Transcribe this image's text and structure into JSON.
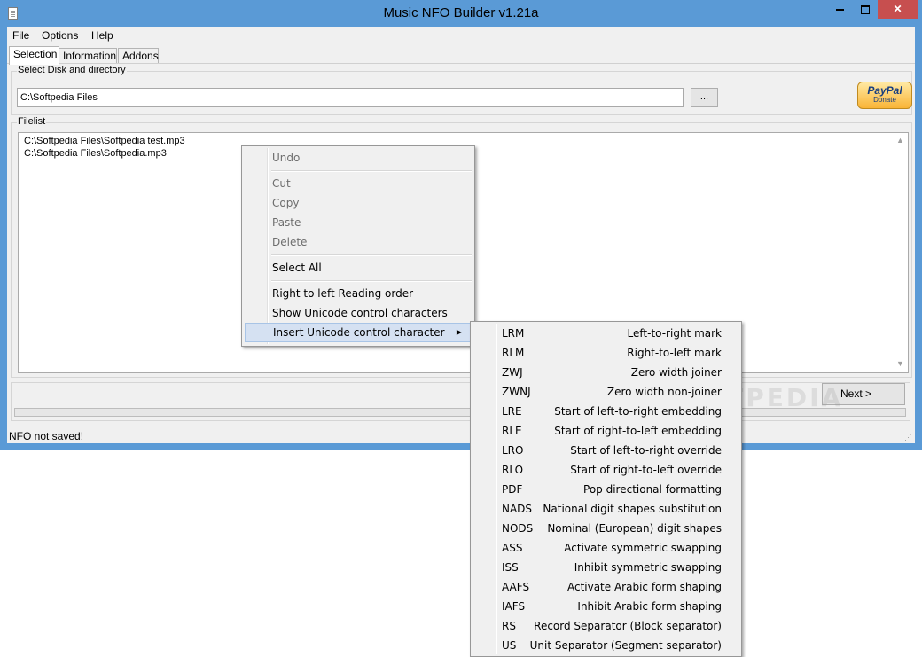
{
  "window": {
    "title": "Music NFO Builder v1.21a",
    "close_glyph": "✕"
  },
  "menubar": [
    "File",
    "Options",
    "Help"
  ],
  "tabs": [
    "Selection",
    "Information",
    "Addons"
  ],
  "selection": {
    "dir_group_label": "Select Disk and directory",
    "path_value": "C:\\Softpedia Files",
    "browse_label": "...",
    "paypal_logo": "PayPal",
    "paypal_donate": "Donate",
    "filelist_label": "Filelist",
    "files": [
      "C:\\Softpedia Files\\Softpedia test.mp3",
      "C:\\Softpedia Files\\Softpedia.mp3"
    ],
    "next_label": "Next >"
  },
  "status": "NFO not saved!",
  "context_menu": {
    "undo": "Undo",
    "cut": "Cut",
    "copy": "Copy",
    "paste": "Paste",
    "delete": "Delete",
    "select_all": "Select All",
    "rtl": "Right to left Reading order",
    "show_unicode": "Show Unicode control characters",
    "insert_unicode": "Insert Unicode control character"
  },
  "unicode_submenu": [
    {
      "code": "LRM",
      "desc": "Left-to-right mark"
    },
    {
      "code": "RLM",
      "desc": "Right-to-left mark"
    },
    {
      "code": "ZWJ",
      "desc": "Zero width joiner"
    },
    {
      "code": "ZWNJ",
      "desc": "Zero width non-joiner"
    },
    {
      "code": "LRE",
      "desc": "Start of left-to-right embedding"
    },
    {
      "code": "RLE",
      "desc": "Start of right-to-left embedding"
    },
    {
      "code": "LRO",
      "desc": "Start of left-to-right override"
    },
    {
      "code": "RLO",
      "desc": "Start of right-to-left override"
    },
    {
      "code": "PDF",
      "desc": "Pop directional formatting"
    },
    {
      "code": "NADS",
      "desc": "National digit shapes substitution"
    },
    {
      "code": "NODS",
      "desc": "Nominal (European) digit shapes"
    },
    {
      "code": "ASS",
      "desc": "Activate symmetric swapping"
    },
    {
      "code": "ISS",
      "desc": "Inhibit symmetric swapping"
    },
    {
      "code": "AAFS",
      "desc": "Activate Arabic form shaping"
    },
    {
      "code": "IAFS",
      "desc": "Inhibit Arabic form shaping"
    },
    {
      "code": "RS",
      "desc": "Record Separator (Block separator)"
    },
    {
      "code": "US",
      "desc": "Unit Separator (Segment separator)"
    }
  ],
  "watermark": "SOFTPEDIA",
  "colors": {
    "titlebar": "#5a9ad6",
    "close_button": "#c74f4f",
    "menu_hover": "#d5e1f2"
  }
}
